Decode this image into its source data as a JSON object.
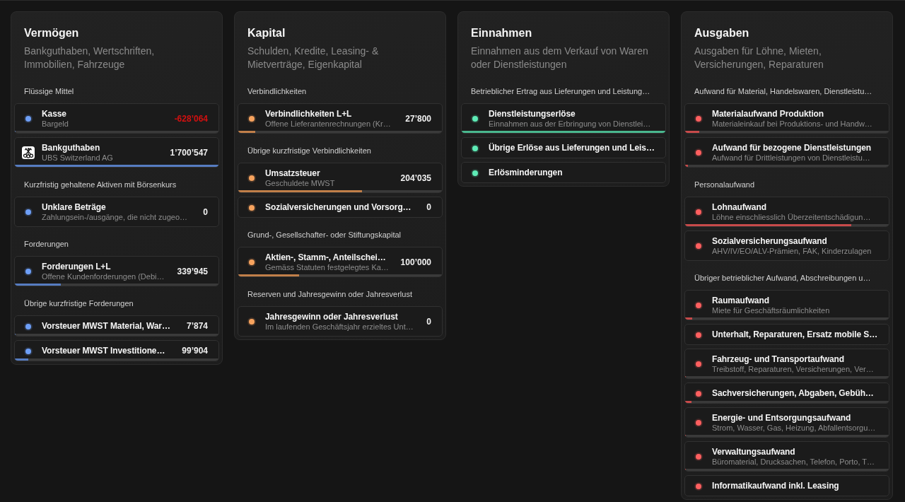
{
  "columns": [
    {
      "title": "Vermögen",
      "description": "Bankguthaben, Wertschriften, Immobilien, Fahrzeuge",
      "color": "#6e9ff7",
      "groups": [
        {
          "title": "Flüssige Mittel",
          "accounts": [
            {
              "kind": "account",
              "name": "Kasse",
              "description": "Bargeld",
              "amount": "-628’064",
              "negative": true,
              "level": 0
            },
            {
              "kind": "bank",
              "name": "Bankguthaben",
              "description": "UBS Switzerland AG",
              "amount": "1’700’547",
              "negative": false,
              "level": 1
            }
          ]
        },
        {
          "title": "Kurzfristig gehaltene Aktiven mit Börsenkurs",
          "accounts": [
            {
              "kind": "account",
              "name": "Unklare Beträge",
              "description": "Zahlungsein-/ausgänge, die nicht zugeo…",
              "amount": "0",
              "negative": false
            }
          ]
        },
        {
          "title": "Forderungen",
          "accounts": [
            {
              "kind": "account",
              "name": "Forderungen L+L",
              "description": "Offene Kundenforderungen (Debi…",
              "amount": "339’945",
              "negative": false,
              "level": 0.224
            }
          ]
        },
        {
          "title": "Übrige kurzfristige Forderungen",
          "accounts": [
            {
              "kind": "account",
              "name": "Vorsteuer MWST Material, War…",
              "amount": "7’874",
              "negative": false,
              "level": 0.005
            },
            {
              "kind": "account",
              "name": "Vorsteuer MWST Investitione…",
              "amount": "99’904",
              "negative": false,
              "level": 0.066
            }
          ]
        }
      ]
    },
    {
      "title": "Kapital",
      "description": "Schulden, Kredite, Leasing- & Mietverträge, Eigenkapital",
      "color": "#f7a35e",
      "groups": [
        {
          "title": "Verbindlichkeiten",
          "accounts": [
            {
              "kind": "account",
              "name": "Verbindlichkeiten L+L",
              "description": "Offene Lieferantenrechnungen (Kr…",
              "amount": "27’800",
              "negative": false,
              "level": 0.083
            }
          ]
        },
        {
          "title": "Übrige kurzfristige Verbindlichkeiten",
          "accounts": [
            {
              "kind": "account",
              "name": "Umsatzsteuer",
              "description": "Geschuldete MWST",
              "amount": "204’035",
              "negative": false,
              "level": 0.607
            },
            {
              "kind": "account",
              "name": "Sozialversicherungen und Vorsorg…",
              "amount": "0",
              "negative": false
            }
          ]
        },
        {
          "title": "Grund-, Gesellschafter- oder Stiftungskapital",
          "accounts": [
            {
              "kind": "account",
              "name": "Aktien-, Stamm-, Anteilschei…",
              "description": "Gemäss Statuten festgelegtes Ka…",
              "amount": "100’000",
              "negative": false,
              "level": 0.298
            }
          ]
        },
        {
          "title": "Reserven und Jahresgewinn oder Jahresverlust",
          "accounts": [
            {
              "kind": "account",
              "name": "Jahresgewinn oder Jahresverlust",
              "description": "Im laufenden Geschäftsjahr erzieltes Unt…",
              "amount": "0",
              "negative": false
            }
          ]
        }
      ]
    },
    {
      "title": "Einnahmen",
      "description": "Einnahmen aus dem Verkauf von Waren oder Dienstleistungen",
      "color": "#5eebb6",
      "groups": [
        {
          "title": "Betrieblicher Ertrag aus Lieferungen und Leistung…",
          "accounts": [
            {
              "kind": "account",
              "name": "Dienstleistungserlöse",
              "description": "Einnahmen aus der Erbringung von Dienstlei…",
              "level": 1
            },
            {
              "kind": "account",
              "name": "Übrige Erlöse aus Lieferungen und Leis…"
            },
            {
              "kind": "account",
              "name": "Erlösminderungen"
            }
          ]
        }
      ]
    },
    {
      "title": "Ausgaben",
      "description": "Ausgaben für Löhne, Mieten, Versicherungen, Reparaturen",
      "color": "#ff5f5f",
      "groups": [
        {
          "title": "Aufwand für Material, Handelswaren, Dienstleistu…",
          "accounts": [
            {
              "kind": "account",
              "name": "Materialaufwand Produktion",
              "description": "Materialeinkauf bei Produktions- und Handw…",
              "level": 0.07
            },
            {
              "kind": "account",
              "name": "Aufwand für bezogene Dienstleistungen",
              "description": "Aufwand für Drittleistungen von Dienstleistu…",
              "level": 0.015
            }
          ]
        },
        {
          "title": "Personalaufwand",
          "accounts": [
            {
              "kind": "account",
              "name": "Lohnaufwand",
              "description": "Löhne einschliesslich Überzeitentschädigun…",
              "level": 0.815
            },
            {
              "kind": "account",
              "name": "Sozialversicherungsaufwand",
              "description": "AHV/IV/EO/ALV-Prämien, FAK, Kinderzulagen"
            }
          ]
        },
        {
          "title": "Übriger betrieblicher Aufwand, Abschreibungen u…",
          "accounts": [
            {
              "kind": "account",
              "name": "Raumaufwand",
              "description": "Miete für Geschäftsräumlichkeiten",
              "level": 0.035
            },
            {
              "kind": "account",
              "name": "Unterhalt, Reparaturen, Ersatz mobile S…"
            },
            {
              "kind": "account",
              "name": "Fahrzeug- und Transportaufwand",
              "description": "Treibstoff, Reparaturen, Versicherungen, Ver…",
              "level": 0
            },
            {
              "kind": "account",
              "name": "Sachversicherungen, Abgaben, Gebüh…",
              "level": 0.03
            },
            {
              "kind": "account",
              "name": "Energie- und Entsorgungsaufwand",
              "description": "Strom, Wasser, Gas, Heizung, Abfallentsorgu…",
              "level": 0
            },
            {
              "kind": "account",
              "name": "Verwaltungsaufwand",
              "description": "Büromaterial, Drucksachen, Telefon, Porto, T…",
              "level": 0
            },
            {
              "kind": "account",
              "name": "Informatikaufwand inkl. Leasing"
            }
          ]
        }
      ]
    }
  ]
}
